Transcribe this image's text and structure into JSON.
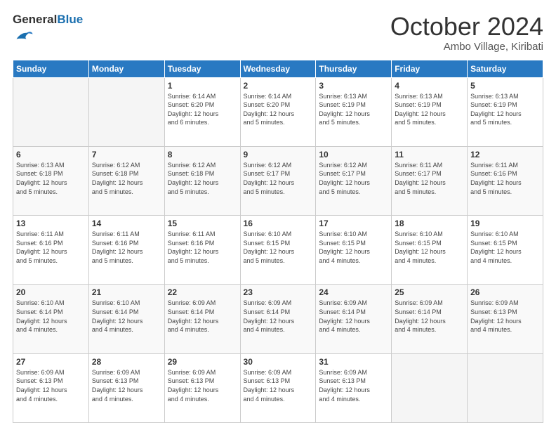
{
  "header": {
    "logo_line1": "General",
    "logo_line2": "Blue",
    "month": "October 2024",
    "location": "Ambo Village, Kiribati"
  },
  "weekdays": [
    "Sunday",
    "Monday",
    "Tuesday",
    "Wednesday",
    "Thursday",
    "Friday",
    "Saturday"
  ],
  "weeks": [
    [
      {
        "day": "",
        "info": ""
      },
      {
        "day": "",
        "info": ""
      },
      {
        "day": "1",
        "info": "Sunrise: 6:14 AM\nSunset: 6:20 PM\nDaylight: 12 hours\nand 6 minutes."
      },
      {
        "day": "2",
        "info": "Sunrise: 6:14 AM\nSunset: 6:20 PM\nDaylight: 12 hours\nand 5 minutes."
      },
      {
        "day": "3",
        "info": "Sunrise: 6:13 AM\nSunset: 6:19 PM\nDaylight: 12 hours\nand 5 minutes."
      },
      {
        "day": "4",
        "info": "Sunrise: 6:13 AM\nSunset: 6:19 PM\nDaylight: 12 hours\nand 5 minutes."
      },
      {
        "day": "5",
        "info": "Sunrise: 6:13 AM\nSunset: 6:19 PM\nDaylight: 12 hours\nand 5 minutes."
      }
    ],
    [
      {
        "day": "6",
        "info": "Sunrise: 6:13 AM\nSunset: 6:18 PM\nDaylight: 12 hours\nand 5 minutes."
      },
      {
        "day": "7",
        "info": "Sunrise: 6:12 AM\nSunset: 6:18 PM\nDaylight: 12 hours\nand 5 minutes."
      },
      {
        "day": "8",
        "info": "Sunrise: 6:12 AM\nSunset: 6:18 PM\nDaylight: 12 hours\nand 5 minutes."
      },
      {
        "day": "9",
        "info": "Sunrise: 6:12 AM\nSunset: 6:17 PM\nDaylight: 12 hours\nand 5 minutes."
      },
      {
        "day": "10",
        "info": "Sunrise: 6:12 AM\nSunset: 6:17 PM\nDaylight: 12 hours\nand 5 minutes."
      },
      {
        "day": "11",
        "info": "Sunrise: 6:11 AM\nSunset: 6:17 PM\nDaylight: 12 hours\nand 5 minutes."
      },
      {
        "day": "12",
        "info": "Sunrise: 6:11 AM\nSunset: 6:16 PM\nDaylight: 12 hours\nand 5 minutes."
      }
    ],
    [
      {
        "day": "13",
        "info": "Sunrise: 6:11 AM\nSunset: 6:16 PM\nDaylight: 12 hours\nand 5 minutes."
      },
      {
        "day": "14",
        "info": "Sunrise: 6:11 AM\nSunset: 6:16 PM\nDaylight: 12 hours\nand 5 minutes."
      },
      {
        "day": "15",
        "info": "Sunrise: 6:11 AM\nSunset: 6:16 PM\nDaylight: 12 hours\nand 5 minutes."
      },
      {
        "day": "16",
        "info": "Sunrise: 6:10 AM\nSunset: 6:15 PM\nDaylight: 12 hours\nand 5 minutes."
      },
      {
        "day": "17",
        "info": "Sunrise: 6:10 AM\nSunset: 6:15 PM\nDaylight: 12 hours\nand 4 minutes."
      },
      {
        "day": "18",
        "info": "Sunrise: 6:10 AM\nSunset: 6:15 PM\nDaylight: 12 hours\nand 4 minutes."
      },
      {
        "day": "19",
        "info": "Sunrise: 6:10 AM\nSunset: 6:15 PM\nDaylight: 12 hours\nand 4 minutes."
      }
    ],
    [
      {
        "day": "20",
        "info": "Sunrise: 6:10 AM\nSunset: 6:14 PM\nDaylight: 12 hours\nand 4 minutes."
      },
      {
        "day": "21",
        "info": "Sunrise: 6:10 AM\nSunset: 6:14 PM\nDaylight: 12 hours\nand 4 minutes."
      },
      {
        "day": "22",
        "info": "Sunrise: 6:09 AM\nSunset: 6:14 PM\nDaylight: 12 hours\nand 4 minutes."
      },
      {
        "day": "23",
        "info": "Sunrise: 6:09 AM\nSunset: 6:14 PM\nDaylight: 12 hours\nand 4 minutes."
      },
      {
        "day": "24",
        "info": "Sunrise: 6:09 AM\nSunset: 6:14 PM\nDaylight: 12 hours\nand 4 minutes."
      },
      {
        "day": "25",
        "info": "Sunrise: 6:09 AM\nSunset: 6:14 PM\nDaylight: 12 hours\nand 4 minutes."
      },
      {
        "day": "26",
        "info": "Sunrise: 6:09 AM\nSunset: 6:13 PM\nDaylight: 12 hours\nand 4 minutes."
      }
    ],
    [
      {
        "day": "27",
        "info": "Sunrise: 6:09 AM\nSunset: 6:13 PM\nDaylight: 12 hours\nand 4 minutes."
      },
      {
        "day": "28",
        "info": "Sunrise: 6:09 AM\nSunset: 6:13 PM\nDaylight: 12 hours\nand 4 minutes."
      },
      {
        "day": "29",
        "info": "Sunrise: 6:09 AM\nSunset: 6:13 PM\nDaylight: 12 hours\nand 4 minutes."
      },
      {
        "day": "30",
        "info": "Sunrise: 6:09 AM\nSunset: 6:13 PM\nDaylight: 12 hours\nand 4 minutes."
      },
      {
        "day": "31",
        "info": "Sunrise: 6:09 AM\nSunset: 6:13 PM\nDaylight: 12 hours\nand 4 minutes."
      },
      {
        "day": "",
        "info": ""
      },
      {
        "day": "",
        "info": ""
      }
    ]
  ]
}
